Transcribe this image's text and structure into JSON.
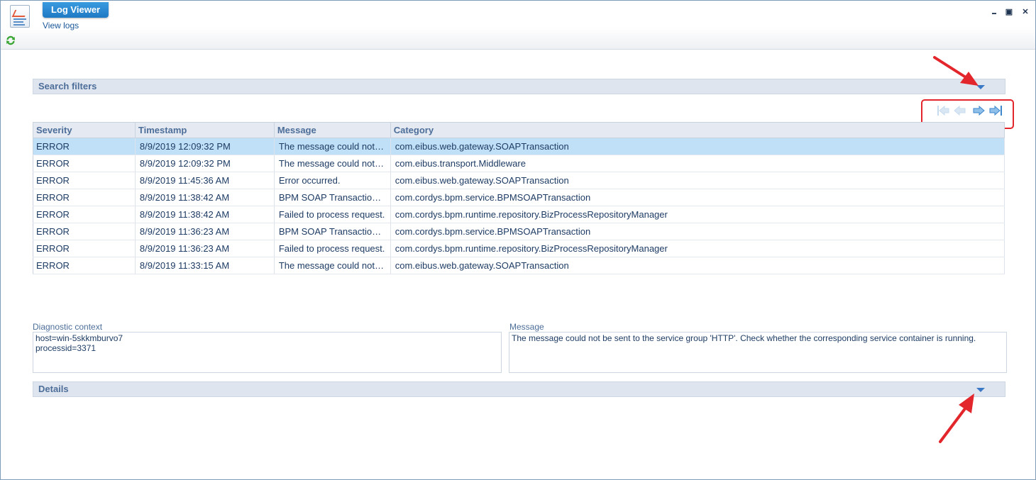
{
  "window": {
    "title": "Log Viewer",
    "subtitle": "View logs",
    "minimize_glyph": "▬",
    "maximize_glyph": "▣",
    "close_glyph": "✕"
  },
  "search_filters": {
    "label": "Search filters"
  },
  "table": {
    "columns": [
      "Severity",
      "Timestamp",
      "Message",
      "Category"
    ],
    "rows": [
      {
        "severity": "ERROR",
        "timestamp": "8/9/2019 12:09:32 PM",
        "message": "The message could not be sent to the service group 'HTTP'.",
        "category": "com.eibus.web.gateway.SOAPTransaction"
      },
      {
        "severity": "ERROR",
        "timestamp": "8/9/2019 12:09:32 PM",
        "message": "The message could not be sent.",
        "category": "com.eibus.transport.Middleware"
      },
      {
        "severity": "ERROR",
        "timestamp": "8/9/2019 11:45:36 AM",
        "message": "Error occurred.",
        "category": "com.eibus.web.gateway.SOAPTransaction"
      },
      {
        "severity": "ERROR",
        "timestamp": "8/9/2019 11:38:42 AM",
        "message": "BPM SOAP Transaction failed.",
        "category": "com.cordys.bpm.service.BPMSOAPTransaction"
      },
      {
        "severity": "ERROR",
        "timestamp": "8/9/2019 11:38:42 AM",
        "message": "Failed to process request.",
        "category": "com.cordys.bpm.runtime.repository.BizProcessRepositoryManager"
      },
      {
        "severity": "ERROR",
        "timestamp": "8/9/2019 11:36:23 AM",
        "message": "BPM SOAP Transaction failed.",
        "category": "com.cordys.bpm.service.BPMSOAPTransaction"
      },
      {
        "severity": "ERROR",
        "timestamp": "8/9/2019 11:36:23 AM",
        "message": "Failed to process request.",
        "category": "com.cordys.bpm.runtime.repository.BizProcessRepositoryManager"
      },
      {
        "severity": "ERROR",
        "timestamp": "8/9/2019 11:33:15 AM",
        "message": "The message could not be sent to the service group.",
        "category": "com.eibus.web.gateway.SOAPTransaction"
      }
    ],
    "selected_row": 0
  },
  "diagnostic": {
    "label": "Diagnostic context",
    "value": "host=win-5skkmburvo7\nprocessid=3371"
  },
  "message_panel": {
    "label": "Message",
    "value": "The message could not be sent to the service group 'HTTP'. Check whether the corresponding service container is running."
  },
  "details": {
    "label": "Details"
  },
  "colors": {
    "accent": "#1f79c4",
    "selection": "#bfe0f7",
    "annotation_red": "#e3262b"
  }
}
